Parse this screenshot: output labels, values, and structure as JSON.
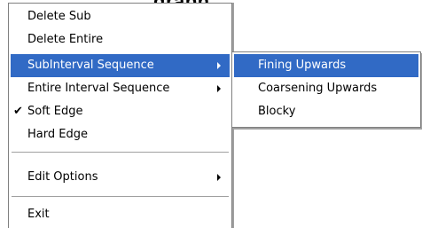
{
  "top_text": "graph",
  "main_menu": {
    "items": [
      {
        "label": "Delete Sub",
        "has_submenu": false,
        "checked": false,
        "selected": false
      },
      {
        "label": "Delete Entire",
        "has_submenu": false,
        "checked": false,
        "selected": false
      },
      {
        "label": "SubInterval Sequence",
        "has_submenu": true,
        "checked": false,
        "selected": true
      },
      {
        "label": "Entire Interval Sequence",
        "has_submenu": true,
        "checked": false,
        "selected": false
      },
      {
        "label": "Soft Edge",
        "has_submenu": false,
        "checked": true,
        "selected": false
      },
      {
        "label": "Hard Edge",
        "has_submenu": false,
        "checked": false,
        "selected": false
      },
      {
        "label": "Edit Options",
        "has_submenu": true,
        "checked": false,
        "selected": false
      },
      {
        "label": "Exit",
        "has_submenu": false,
        "checked": false,
        "selected": false
      }
    ],
    "check_glyph": "✔"
  },
  "sub_menu": {
    "items": [
      {
        "label": "Fining Upwards",
        "selected": true
      },
      {
        "label": "Coarsening Upwards",
        "selected": false
      },
      {
        "label": "Blocky",
        "selected": false
      }
    ]
  },
  "colors": {
    "highlight": "#316ac5",
    "highlight_text": "#ffffff",
    "border": "#808080"
  }
}
